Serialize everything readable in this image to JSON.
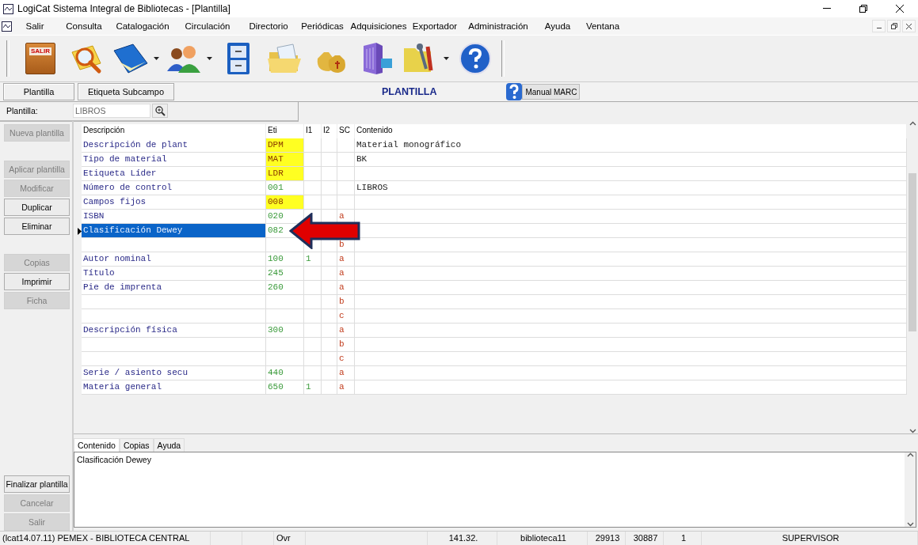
{
  "window": {
    "title": "LogiCat Sistema Integral de Bibliotecas - [Plantilla]"
  },
  "menu": [
    "Salir",
    "Consulta",
    "Catalogación",
    "Circulación",
    "Directorio",
    "Periódicas",
    "Adquisiciones",
    "Exportador",
    "Administración",
    "Ayuda",
    "Ventana"
  ],
  "toolbar": [
    {
      "kind": "exit",
      "label": "SALIR",
      "has_menu": false
    },
    {
      "kind": "search",
      "has_menu": false
    },
    {
      "kind": "book",
      "has_menu": true
    },
    {
      "kind": "people",
      "has_menu": true
    },
    {
      "kind": "cabinet",
      "has_menu": false
    },
    {
      "kind": "folder",
      "has_menu": false
    },
    {
      "kind": "money",
      "has_menu": false
    },
    {
      "kind": "building",
      "has_menu": false
    },
    {
      "kind": "tools",
      "has_menu": true
    },
    {
      "kind": "help",
      "has_menu": false
    }
  ],
  "view_bar": {
    "buttons": [
      "Plantilla",
      "Etiqueta  Subcampo"
    ],
    "title": "PLANTILLA",
    "manual_button": "Manual MARC"
  },
  "template_field": {
    "label": "Plantilla:",
    "value": "LIBROS"
  },
  "sidebar": {
    "groups": [
      [
        {
          "label": "Nueva plantilla",
          "disabled": true
        }
      ],
      [
        {
          "label": "Aplicar plantilla",
          "disabled": true
        },
        {
          "label": "Modificar",
          "disabled": true
        },
        {
          "label": "Duplicar",
          "disabled": false
        },
        {
          "label": "Eliminar",
          "disabled": false
        }
      ],
      [
        {
          "label": "Copias",
          "disabled": true
        },
        {
          "label": "Imprimir",
          "disabled": false
        },
        {
          "label": "Ficha",
          "disabled": true
        }
      ]
    ],
    "bottom": [
      {
        "label": "Finalizar plantilla",
        "disabled": false
      },
      {
        "label": "Cancelar",
        "disabled": true
      },
      {
        "label": "Salir",
        "disabled": true
      }
    ]
  },
  "table": {
    "columns": [
      "Descripción",
      "Eti",
      "I1",
      "I2",
      "SC",
      "Contenido"
    ],
    "rows": [
      {
        "description": "Descripción de plant",
        "tag": "DPM",
        "tag_highlighted": true,
        "content": "Material monográfico",
        "selected": false
      },
      {
        "description": "Tipo de material",
        "tag": "MAT",
        "tag_highlighted": true,
        "content": "BK",
        "selected": false
      },
      {
        "description": "Etiqueta Líder",
        "tag": "LDR",
        "tag_highlighted": true,
        "selected": false
      },
      {
        "description": "Número de control",
        "tag": "001",
        "tag_highlighted": false,
        "content": "LIBROS",
        "selected": false
      },
      {
        "description": "Campos fijos",
        "tag": "008",
        "tag_highlighted": true,
        "selected": false
      },
      {
        "description": "ISBN",
        "tag": "020",
        "tag_highlighted": false,
        "subfield": "a",
        "selected": false
      },
      {
        "description": "Clasificación Dewey",
        "tag": "082",
        "tag_highlighted": false,
        "selected": true
      },
      {
        "subfield": "b",
        "selected": false
      },
      {
        "description": "Autor nominal",
        "tag": "100",
        "tag_highlighted": false,
        "ind1": "1",
        "subfield": "a",
        "selected": false
      },
      {
        "description": "Título",
        "tag": "245",
        "tag_highlighted": false,
        "subfield": "a",
        "selected": false
      },
      {
        "description": "Pie de imprenta",
        "tag": "260",
        "tag_highlighted": false,
        "subfield": "a",
        "selected": false
      },
      {
        "subfield": "b",
        "selected": false
      },
      {
        "subfield": "c",
        "selected": false
      },
      {
        "description": "Descripción física",
        "tag": "300",
        "tag_highlighted": false,
        "subfield": "a",
        "selected": false
      },
      {
        "subfield": "b",
        "selected": false
      },
      {
        "subfield": "c",
        "selected": false
      },
      {
        "description": "Serie / asiento secu",
        "tag": "440",
        "tag_highlighted": false,
        "subfield": "a",
        "selected": false
      },
      {
        "description": "Materia general",
        "tag": "650",
        "tag_highlighted": false,
        "ind1": "1",
        "subfield": "a",
        "selected": false
      }
    ]
  },
  "bottom_tabs": [
    {
      "label": "Contenido",
      "selected": true
    },
    {
      "label": "Copias",
      "selected": false
    },
    {
      "label": "Ayuda",
      "selected": false
    }
  ],
  "content_text": "Clasificación Dewey",
  "status_bar": {
    "app": "(lcat14.07.11) PEMEX - BIBLIOTECA CENTRAL",
    "mode": "Ovr",
    "address": "141.32.",
    "database": "biblioteca11",
    "counters": [
      "29913",
      "30887",
      "1"
    ],
    "user": "SUPERVISOR"
  }
}
